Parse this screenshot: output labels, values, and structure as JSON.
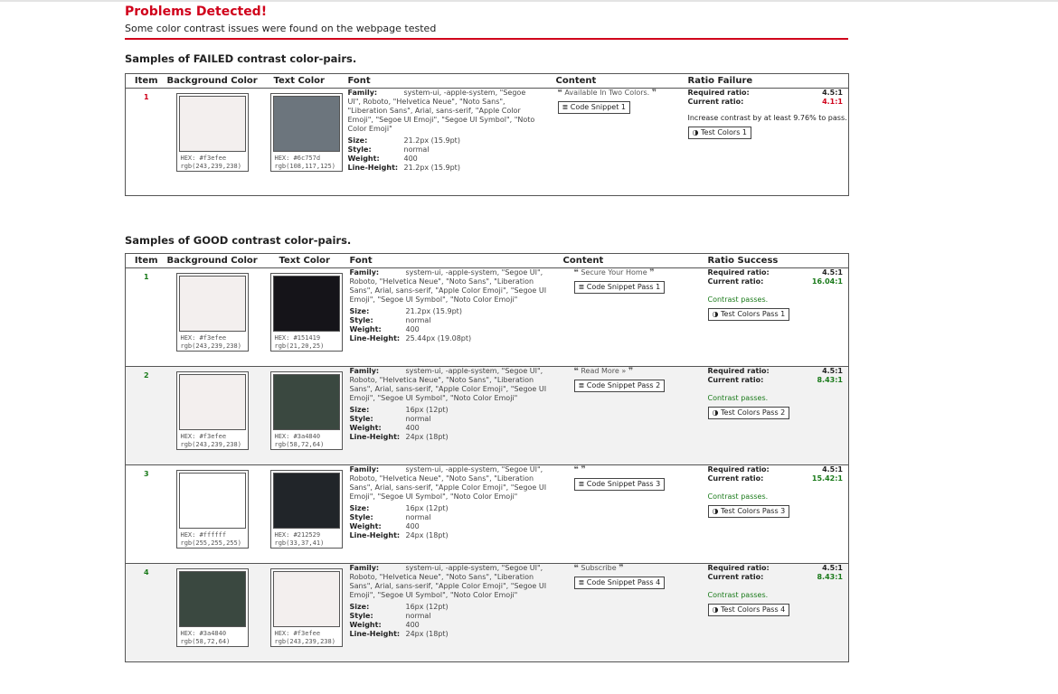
{
  "header": {
    "title": "Problems Detected!",
    "subtitle": "Some color contrast issues were found on the webpage tested"
  },
  "failed": {
    "heading": "Samples of FAILED contrast color-pairs.",
    "columns": [
      "Item",
      "Background Color",
      "Text Color",
      "Font",
      "Content",
      "Ratio Failure"
    ],
    "rows": [
      {
        "item": "1",
        "bg_color": "#f3efee",
        "bg_hex": "HEX: #f3efee",
        "bg_rgb": "rgb(243,239,238)",
        "text_color": "#6c757d",
        "text_hex": "HEX: #6c757d",
        "text_rgb": "rgb(108,117,125)",
        "family_label": "Family:",
        "family": "system-ui, -apple-system, \"Segoe UI\", Roboto, \"Helvetica Neue\", \"Noto Sans\", \"Liberation Sans\", Arial, sans-serif, \"Apple Color Emoji\", \"Segoe UI Emoji\", \"Segoe UI Symbol\", \"Noto Color Emoji\"",
        "size_label": "Size:",
        "size": "21.2px (15.9pt)",
        "style_label": "Style:",
        "style": "normal",
        "weight_label": "Weight:",
        "weight": "400",
        "lh_label": "Line-Height:",
        "line_height": "21.2px (15.9pt)",
        "content_open": "❝",
        "content_text": "Available In Two Colors.",
        "content_close": "❞",
        "snippet_button": "≣ Code Snippet 1",
        "required_label": "Required ratio:",
        "required_value": "4.5:1",
        "current_label": "Current ratio:",
        "current_value": "4.1:1",
        "message": "Increase contrast by at least 9.76% to pass.",
        "test_button": "◑ Test Colors 1"
      }
    ]
  },
  "good": {
    "heading": "Samples of GOOD contrast color-pairs.",
    "columns": [
      "Item",
      "Background Color",
      "Text Color",
      "Font",
      "Content",
      "Ratio Success"
    ],
    "rows": [
      {
        "item": "1",
        "bg_color": "#f3efee",
        "bg_hex": "HEX: #f3efee",
        "bg_rgb": "rgb(243,239,238)",
        "text_color": "#151419",
        "text_hex": "HEX: #151419",
        "text_rgb": "rgb(21,20,25)",
        "family_label": "Family:",
        "family": "system-ui, -apple-system, \"Segoe UI\", Roboto, \"Helvetica Neue\", \"Noto Sans\", \"Liberation Sans\", Arial, sans-serif, \"Apple Color Emoji\", \"Segoe UI Emoji\", \"Segoe UI Symbol\", \"Noto Color Emoji\"",
        "size_label": "Size:",
        "size": "21.2px (15.9pt)",
        "style_label": "Style:",
        "style": "normal",
        "weight_label": "Weight:",
        "weight": "400",
        "lh_label": "Line-Height:",
        "line_height": "25.44px (19.08pt)",
        "content_open": "❝",
        "content_text": "Secure Your Home",
        "content_close": "❞",
        "snippet_button": "≣ Code Snippet Pass 1",
        "required_label": "Required ratio:",
        "required_value": "4.5:1",
        "current_label": "Current ratio:",
        "current_value": "16.04:1",
        "message": "Contrast passes.",
        "test_button": "◑ Test Colors Pass 1"
      },
      {
        "item": "2",
        "bg_color": "#f3efee",
        "bg_hex": "HEX: #f3efee",
        "bg_rgb": "rgb(243,239,238)",
        "text_color": "#3a4840",
        "text_hex": "HEX: #3a4840",
        "text_rgb": "rgb(58,72,64)",
        "family_label": "Family:",
        "family": "system-ui, -apple-system, \"Segoe UI\", Roboto, \"Helvetica Neue\", \"Noto Sans\", \"Liberation Sans\", Arial, sans-serif, \"Apple Color Emoji\", \"Segoe UI Emoji\", \"Segoe UI Symbol\", \"Noto Color Emoji\"",
        "size_label": "Size:",
        "size": "16px (12pt)",
        "style_label": "Style:",
        "style": "normal",
        "weight_label": "Weight:",
        "weight": "400",
        "lh_label": "Line-Height:",
        "line_height": "24px (18pt)",
        "content_open": "❝",
        "content_text": "Read More »",
        "content_close": "❞",
        "snippet_button": "≣ Code Snippet Pass 2",
        "required_label": "Required ratio:",
        "required_value": "4.5:1",
        "current_label": "Current ratio:",
        "current_value": "8.43:1",
        "message": "Contrast passes.",
        "test_button": "◑ Test Colors Pass 2"
      },
      {
        "item": "3",
        "bg_color": "#ffffff",
        "bg_hex": "HEX: #ffffff",
        "bg_rgb": "rgb(255,255,255)",
        "text_color": "#212529",
        "text_hex": "HEX: #212529",
        "text_rgb": "rgb(33,37,41)",
        "family_label": "Family:",
        "family": "system-ui, -apple-system, \"Segoe UI\", Roboto, \"Helvetica Neue\", \"Noto Sans\", \"Liberation Sans\", Arial, sans-serif, \"Apple Color Emoji\", \"Segoe UI Emoji\", \"Segoe UI Symbol\", \"Noto Color Emoji\"",
        "size_label": "Size:",
        "size": "16px (12pt)",
        "style_label": "Style:",
        "style": "normal",
        "weight_label": "Weight:",
        "weight": "400",
        "lh_label": "Line-Height:",
        "line_height": "24px (18pt)",
        "content_open": "❝",
        "content_text": "",
        "content_close": "❞",
        "snippet_button": "≣ Code Snippet Pass 3",
        "required_label": "Required ratio:",
        "required_value": "4.5:1",
        "current_label": "Current ratio:",
        "current_value": "15.42:1",
        "message": "Contrast passes.",
        "test_button": "◑ Test Colors Pass 3"
      },
      {
        "item": "4",
        "bg_color": "#3a4840",
        "bg_hex": "HEX: #3a4840",
        "bg_rgb": "rgb(58,72,64)",
        "text_color": "#f3efee",
        "text_hex": "HEX: #f3efee",
        "text_rgb": "rgb(243,239,238)",
        "family_label": "Family:",
        "family": "system-ui, -apple-system, \"Segoe UI\", Roboto, \"Helvetica Neue\", \"Noto Sans\", \"Liberation Sans\", Arial, sans-serif, \"Apple Color Emoji\", \"Segoe UI Emoji\", \"Segoe UI Symbol\", \"Noto Color Emoji\"",
        "size_label": "Size:",
        "size": "16px (12pt)",
        "style_label": "Style:",
        "style": "normal",
        "weight_label": "Weight:",
        "weight": "400",
        "lh_label": "Line-Height:",
        "line_height": "24px (18pt)",
        "content_open": "❝",
        "content_text": "Subscribe",
        "content_close": "❞",
        "snippet_button": "≣ Code Snippet Pass 4",
        "required_label": "Required ratio:",
        "required_value": "4.5:1",
        "current_label": "Current ratio:",
        "current_value": "8.43:1",
        "message": "Contrast passes.",
        "test_button": "◑ Test Colors Pass 4"
      }
    ]
  },
  "colors": {
    "accent_red": "#d0021b",
    "pass_green": "#1a7a1a",
    "alt_row": "#f2f2f2"
  }
}
